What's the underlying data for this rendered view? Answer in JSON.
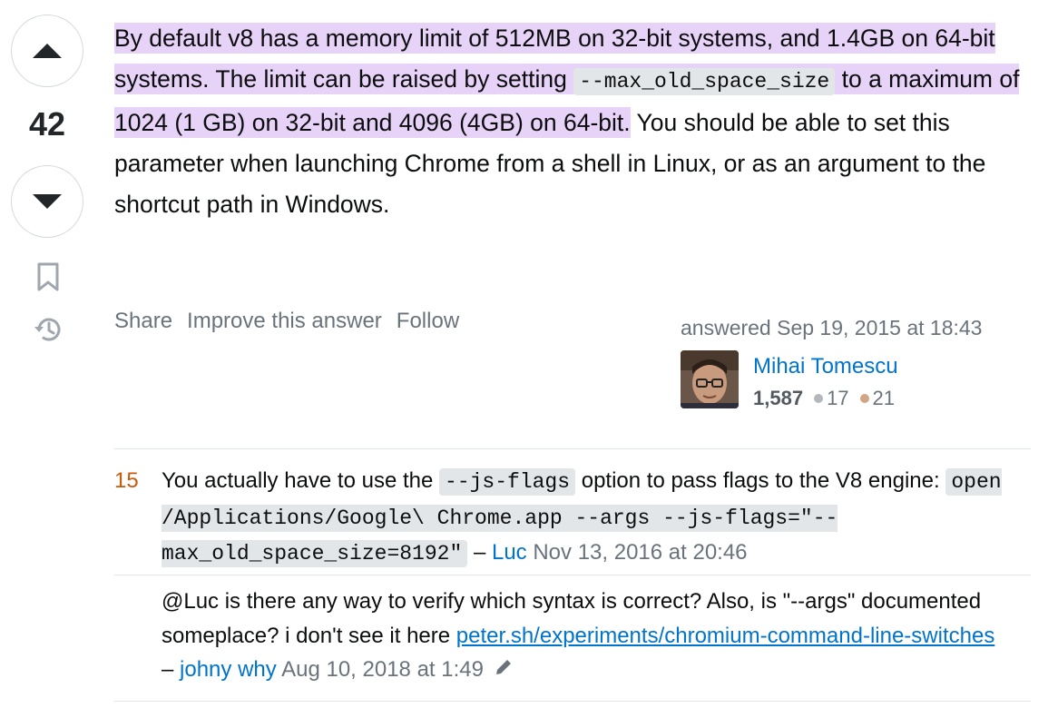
{
  "vote": {
    "count": "42"
  },
  "post": {
    "hl_1": "By default v8 has a memory limit of 512MB on 32-bit systems, and 1.4GB on 64-bit systems. The limit can be raised by setting",
    "code": "--max_old_space_size",
    "hl_2": "to a maximum of 1024 (1 GB) on 32-bit and 4096 (4GB) on 64-bit.",
    "rest": "You should be able to set this parameter when launching Chrome from a shell in Linux, or as an argument to the shortcut path in Windows."
  },
  "menu": {
    "share": "Share",
    "improve": "Improve this answer",
    "follow": "Follow"
  },
  "author": {
    "answered": "answered Sep 19, 2015 at 18:43",
    "name": "Mihai Tomescu",
    "reputation": "1,587",
    "silver": "17",
    "bronze": "21"
  },
  "comments": [
    {
      "score": "15",
      "text_1": "You actually have to use the",
      "code_1": "--js-flags",
      "text_2": "option to pass flags to the V8 engine:",
      "code_2": "open /Applications/Google\\ Chrome.app --args --js-flags=\"--max_old_space_size=8192\"",
      "sep": "–",
      "user": "Luc",
      "date": "Nov 13, 2016 at 20:46"
    },
    {
      "text_1": "@Luc is there any way to verify which syntax is correct? Also, is \"--args\" documented someplace? i don't see it here",
      "link": "peter.sh/experiments/chromium-command-line-switches",
      "sep": "–",
      "user": "johny why",
      "date": "Aug 10, 2018 at 1:49"
    }
  ],
  "colors": {
    "highlight": "#e8d3f8",
    "link": "#0074cc",
    "comment_score": "#c85a0c",
    "silver": "#b4b8bc",
    "bronze": "#d1a684"
  },
  "icons": [
    "upvote-icon",
    "downvote-icon",
    "bookmark-icon",
    "history-icon",
    "pencil-icon"
  ]
}
